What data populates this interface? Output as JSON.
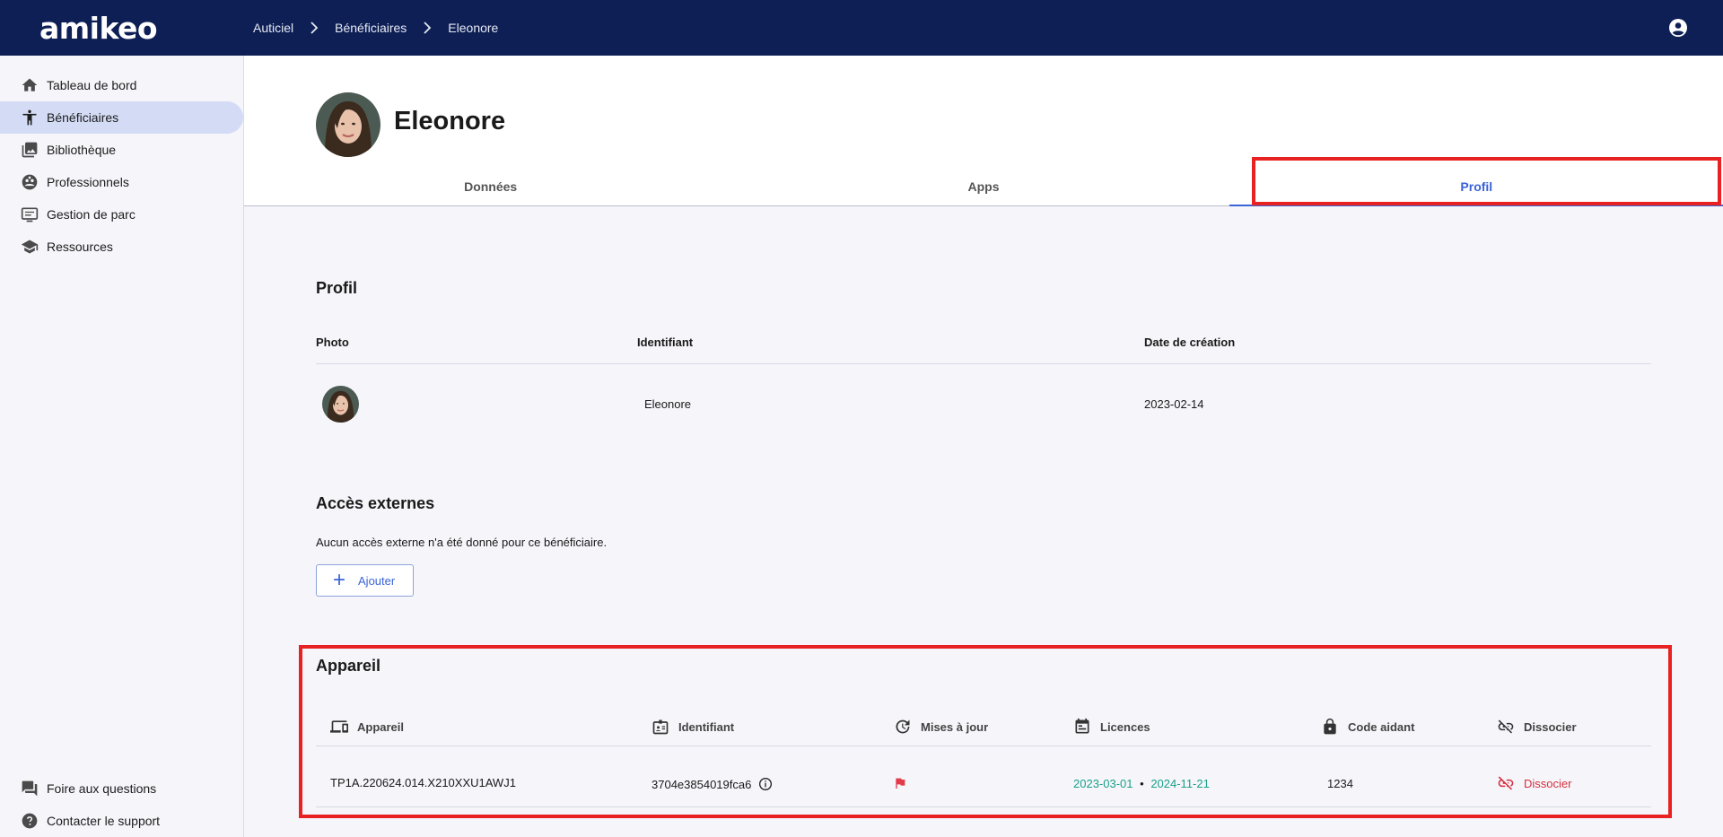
{
  "app": {
    "logo": "amikeo"
  },
  "breadcrumb": {
    "items": [
      "Auticiel",
      "Bénéficiaires",
      "Eleonore"
    ]
  },
  "sidebar": {
    "items": [
      {
        "label": "Tableau de bord",
        "icon": "home-icon"
      },
      {
        "label": "Bénéficiaires",
        "icon": "person-icon",
        "active": true
      },
      {
        "label": "Bibliothèque",
        "icon": "library-icon"
      },
      {
        "label": "Professionnels",
        "icon": "group-icon"
      },
      {
        "label": "Gestion de parc",
        "icon": "devices-icon"
      },
      {
        "label": "Ressources",
        "icon": "school-icon"
      }
    ],
    "bottom": [
      {
        "label": "Foire aux questions",
        "icon": "forum-icon"
      },
      {
        "label": "Contacter le support",
        "icon": "help-icon"
      }
    ]
  },
  "beneficiary": {
    "name": "Eleonore"
  },
  "tabs": [
    {
      "label": "Données"
    },
    {
      "label": "Apps"
    },
    {
      "label": "Profil",
      "active": true
    }
  ],
  "profile": {
    "title": "Profil",
    "headers": {
      "photo": "Photo",
      "identifier": "Identifiant",
      "created": "Date de création"
    },
    "row": {
      "identifier": "Eleonore",
      "created": "2023-02-14"
    }
  },
  "external": {
    "title": "Accès externes",
    "empty_text": "Aucun accès externe n'a été donné pour ce bénéficiaire.",
    "add_label": "Ajouter"
  },
  "device": {
    "title": "Appareil",
    "headers": {
      "device": "Appareil",
      "identifier": "Identifiant",
      "updates": "Mises à jour",
      "licences": "Licences",
      "code": "Code aidant",
      "dissociate": "Dissocier"
    },
    "row": {
      "device": "TP1A.220624.014.X210XXU1AWJ1",
      "identifier": "3704e3854019fca6",
      "licence_start": "2023-03-01",
      "licence_sep": "•",
      "licence_end": "2024-11-21",
      "code": "1234",
      "dissociate": "Dissocier"
    }
  },
  "colors": {
    "topbar": "#0e1f56",
    "accent": "#3a64d8",
    "active_nav": "#d4dcf5",
    "licence": "#1aa08a",
    "danger": "#d6313f",
    "highlight": "#e82222"
  }
}
